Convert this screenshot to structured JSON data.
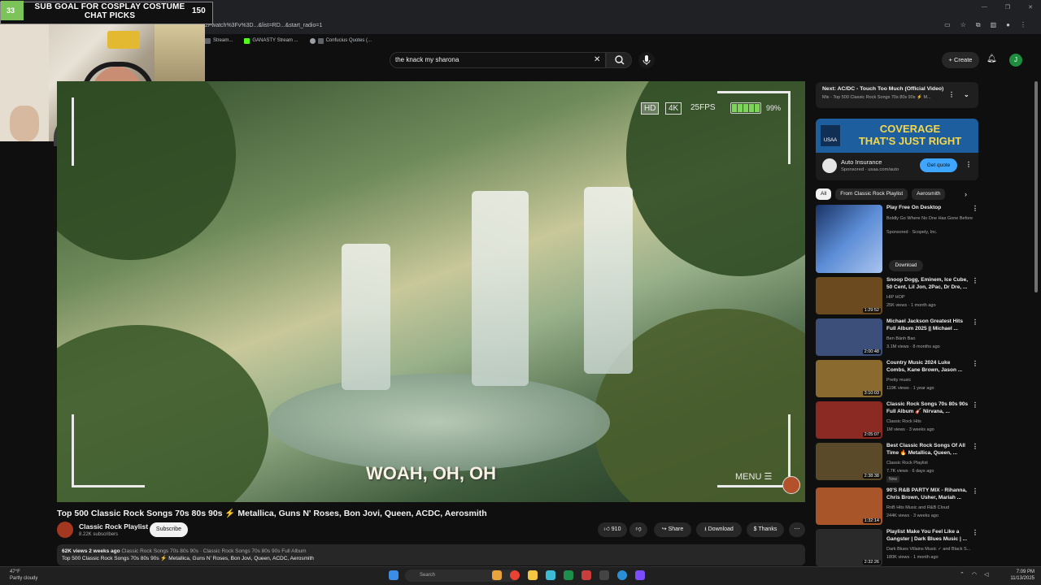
{
  "browser": {
    "address": "2Fwatch%3Fv%3D...&list=RD...&start_radio=1",
    "bookmarks": [
      "Stream...",
      "GANASTY Stream ...",
      "Confucius Quotes (..."
    ]
  },
  "overlay": {
    "goal_current": "33",
    "goal_title_line1": "SUB GOAL FOR COSPLAY COSTUME",
    "goal_title_line2": "CHAT PICKS",
    "goal_target": "150"
  },
  "header": {
    "search_query": "the knack my sharona",
    "create_label": "Create",
    "avatar_letter": "J"
  },
  "player": {
    "hd": "HD",
    "k4": "4K",
    "fps": "25FPS",
    "battery": "99%",
    "lyric": "WOAH, OH, OH",
    "menu": "MENU"
  },
  "video": {
    "title": "Top 500 Classic Rock Songs 70s 80s 90s ⚡ Metallica, Guns N' Roses, Bon Jovi, Queen, ACDC, Aerosmith",
    "channel": "Classic Rock Playlist",
    "subscribers": "8.22K subscribers",
    "subscribe": "Subscribe",
    "likes": "910",
    "share": "Share",
    "download": "Download",
    "thanks": "Thanks",
    "views_age": "62K views  2 weeks ago",
    "tags": "Classic Rock Songs 70s 80s 90s · Classic Rock Songs 70s 80s 90s Full Album",
    "desc_line": "Top 500 Classic Rock Songs 70s 80s 90s ⚡ Metallica, Guns N' Roses, Bon Jovi, Queen, ACDC, Aerosmith"
  },
  "upnext": {
    "label": "Next: AC/DC - Touch Too Much (Official Video)",
    "sub": "Mix - Top 500 Classic Rock Songs 70s 80s 90s ⚡ M..."
  },
  "ad": {
    "headline1": "COVERAGE",
    "headline2": "THAT'S JUST RIGHT",
    "brand": "USAA",
    "title": "Auto Insurance",
    "sponsored": "Sponsored · usaa.com/auto",
    "cta": "Get quote"
  },
  "chips": [
    "All",
    "From Classic Rock Playlist",
    "Aerosmith"
  ],
  "recs": [
    {
      "title": "Play Free On Desktop",
      "channel": "Boldly Go Where No One Has Gone Before",
      "meta": "Sponsored · Scopely, Inc.",
      "duration": "",
      "button": "Download",
      "color": "#3a5d9a"
    },
    {
      "title": "Snoop Dogg, Eminem, Ice Cube, 50 Cent, Lil Jon, 2Pac, Dr Dre, ...",
      "channel": "HIP HOP",
      "meta": "25K views · 1 month ago",
      "duration": "1:29:52",
      "color": "#6b4a1f"
    },
    {
      "title": "Michael Jackson Greatest Hits Full Album 2025 || Michael ...",
      "channel": "Ben Bánh Bao",
      "meta": "3.1M views · 8 months ago",
      "duration": "2:00:48",
      "color": "#3b4f7a"
    },
    {
      "title": "Country Music 2024 Luke Combs, Kane Brown, Jason ...",
      "channel": "Pretty music",
      "meta": "119K views · 1 year ago",
      "duration": "3:10:03",
      "color": "#8a6a2e"
    },
    {
      "title": "Classic Rock Songs 70s 80s 90s Full Album 🎸 Nirvana, ...",
      "channel": "Classic Rock Hits",
      "meta": "1M views · 3 weeks ago",
      "duration": "2:05:07",
      "color": "#8a2a22"
    },
    {
      "title": "Best Classic Rock Songs Of All Time 🔥 Metallica, Queen, ...",
      "channel": "Classic Rock Playlist",
      "meta": "7.7K views · 6 days ago",
      "duration": "2:38:38",
      "badge": "New",
      "color": "#5a4a2a"
    },
    {
      "title": "90'S R&B PARTY MIX - Rihanna, Chris Brown, Usher, Mariah ...",
      "channel": "RnB Hits Music and R&B Cloud",
      "meta": "244K views · 3 weeks ago",
      "duration": "1:32:14",
      "color": "#a8552a"
    },
    {
      "title": "Playlist Make You Feel Like a Gangster | Dark Blues Music | ...",
      "channel": "Dark Blues Villains Music ✓ and Black S...",
      "meta": "180K views · 1 month ago",
      "duration": "2:32:26",
      "color": "#2a2a2a"
    }
  ],
  "taskbar": {
    "temp": "47°F",
    "weather": "Partly cloudy",
    "search": "Search",
    "time": "7:09 PM",
    "date": "11/13/2025"
  }
}
